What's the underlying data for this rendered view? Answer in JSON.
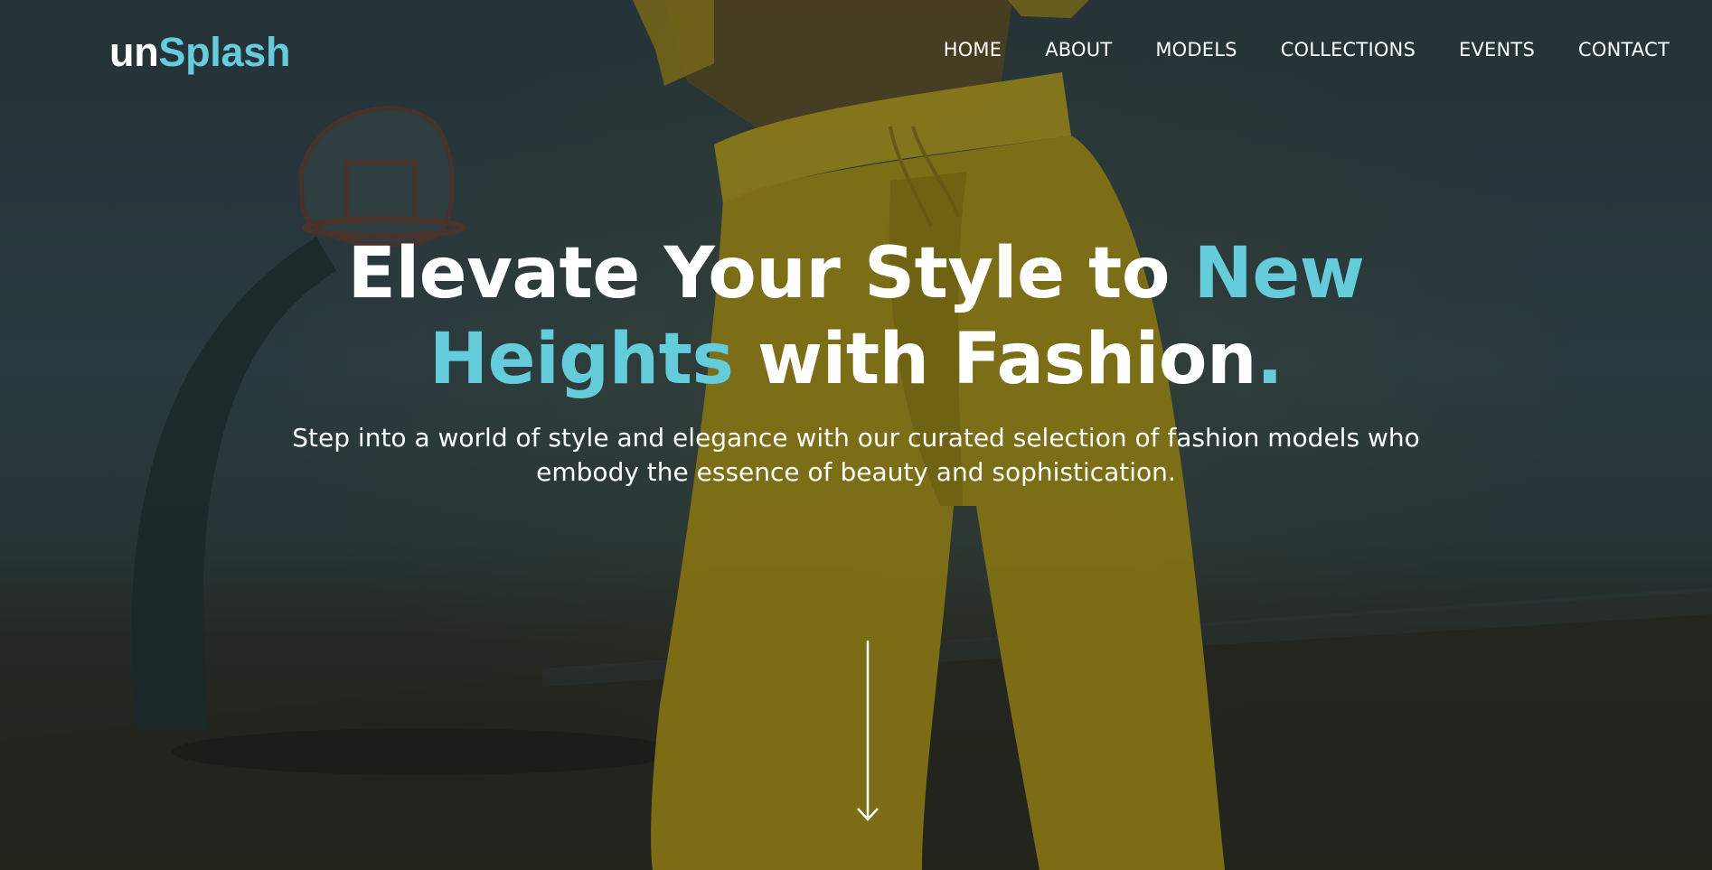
{
  "brand": {
    "name_main": "un",
    "name_accent": "Splash"
  },
  "nav": {
    "items": [
      {
        "label": "HOME"
      },
      {
        "label": "ABOUT"
      },
      {
        "label": "MODELS"
      },
      {
        "label": "COLLECTIONS"
      },
      {
        "label": "EVENTS"
      },
      {
        "label": "CONTACT"
      }
    ]
  },
  "hero": {
    "headline": {
      "line1_white": "Elevate Your Style to ",
      "line1_accent": "New",
      "line2_accent": "Heights",
      "line2_white": " with Fashion",
      "period": "."
    },
    "subtitle": {
      "line1": "Step into a world of style and elegance with our curated selection of fashion models who",
      "line2": "embody the essence of beauty and sophistication."
    },
    "scroll_icon": "arrow-down-icon"
  },
  "colors": {
    "accent": "#65ccdc",
    "text": "#ffffff",
    "overlay_dark": "#2b3a40",
    "figure_yellow": "#a28c16"
  }
}
